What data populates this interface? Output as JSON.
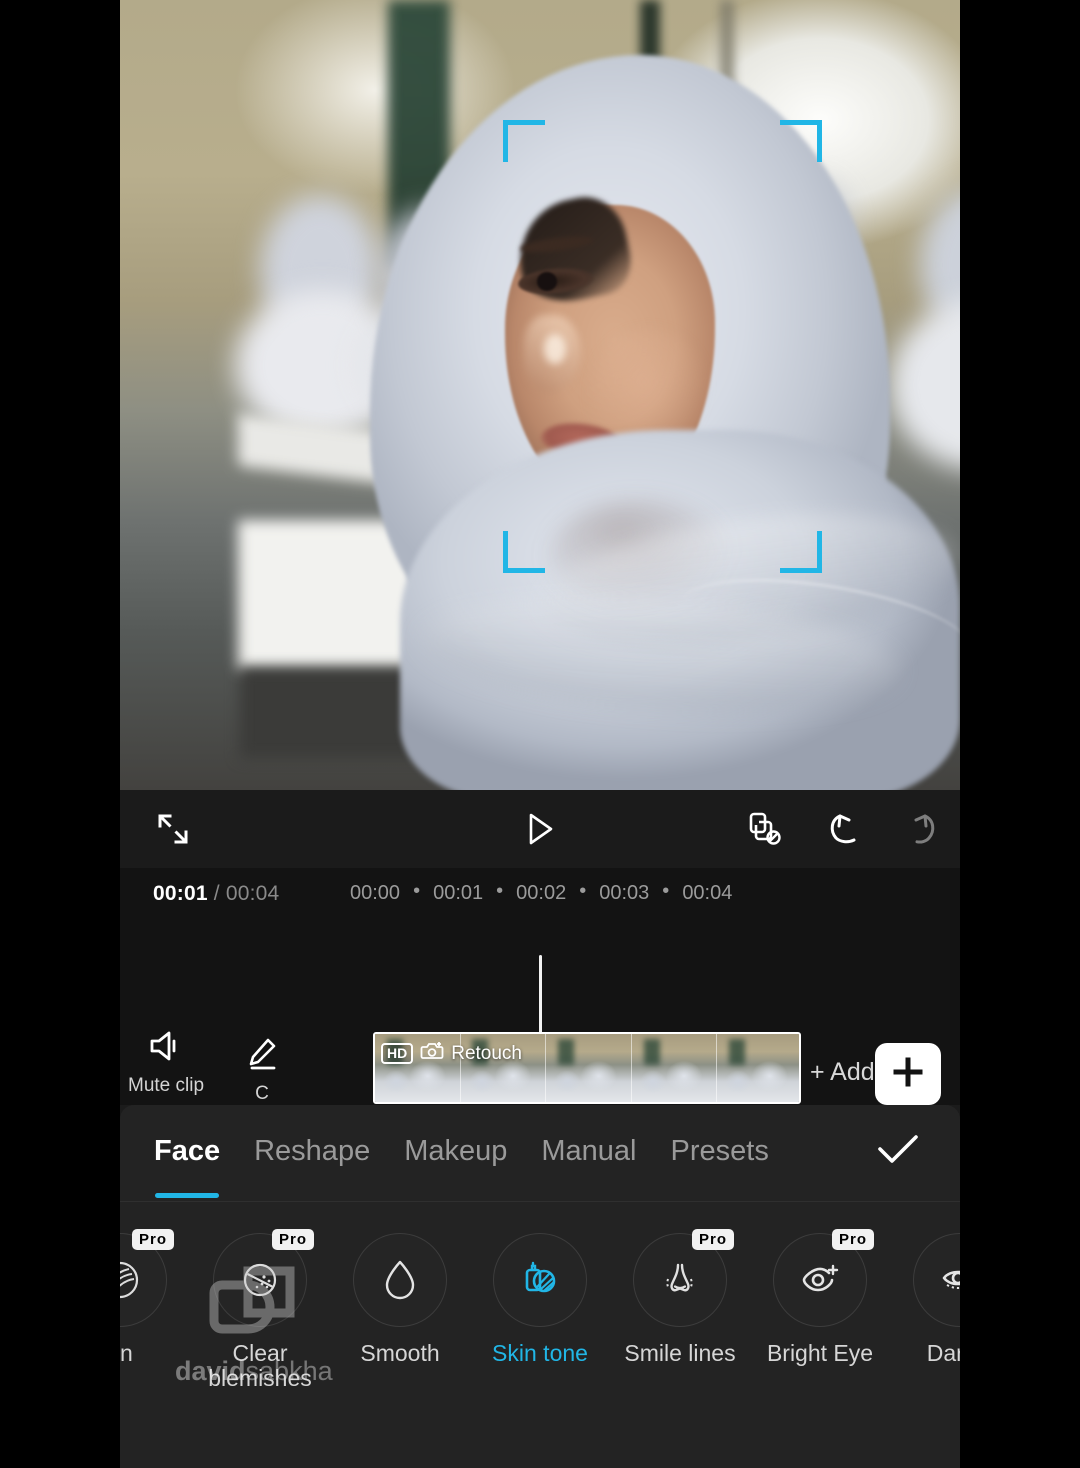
{
  "app": {
    "name": "video-editor",
    "accent_cyan": "#21b6e6",
    "panel_bg": "#232323"
  },
  "preview": {
    "face_detect_brackets": "face-detection-frame",
    "compare_icon": "before-after-compare-icon"
  },
  "player_toolbar": {
    "expand_icon": "fullscreen-expand-icon",
    "play_icon": "play-icon",
    "keyframe_icon": "disable-keyframe-icon",
    "undo_icon": "undo-icon",
    "redo_icon": "redo-icon"
  },
  "timeline": {
    "current_time": "00:01",
    "separator": "/",
    "total_time": "00:04",
    "ruler_ticks": [
      "00:00",
      "00:01",
      "00:02",
      "00:03",
      "00:04"
    ],
    "tick_dot": "•",
    "clip": {
      "hd_badge": "HD",
      "effect_label": "Retouch",
      "retouch_icon": "retouch-icon"
    },
    "left_tools": [
      {
        "icon": "speaker-volume-icon",
        "label": "Mute clip"
      },
      {
        "icon": "pencil-edit-icon",
        "label": "C"
      }
    ],
    "add_clip_label": "+ Add clip",
    "plus_button": "plus-icon"
  },
  "panel": {
    "tabs": [
      {
        "label": "Face",
        "active": true
      },
      {
        "label": "Reshape",
        "active": false
      },
      {
        "label": "Makeup",
        "active": false
      },
      {
        "label": "Manual",
        "active": false
      },
      {
        "label": "Presets",
        "active": false
      }
    ],
    "confirm_icon": "checkmark-icon",
    "tools": [
      {
        "name": "en",
        "icon": "soften-icon",
        "pro": true,
        "active": false
      },
      {
        "name": "Clear\nblemishes",
        "icon": "blemish-icon",
        "pro": true,
        "active": false
      },
      {
        "name": "Smooth",
        "icon": "water-drop-icon",
        "pro": false,
        "active": false
      },
      {
        "name": "Skin tone",
        "icon": "foundation-icon",
        "pro": false,
        "active": true
      },
      {
        "name": "Smile lines",
        "icon": "nose-icon",
        "pro": true,
        "active": false
      },
      {
        "name": "Bright Eye",
        "icon": "bright-eye-icon",
        "pro": true,
        "active": false
      },
      {
        "name": "Dark c",
        "icon": "dark-circles-icon",
        "pro": false,
        "active": false
      }
    ],
    "pro_badge_label": "Pro"
  },
  "watermark": {
    "logo": "davidsabkha-logo",
    "name_bold": "david",
    "name_rest": "sabkha"
  }
}
